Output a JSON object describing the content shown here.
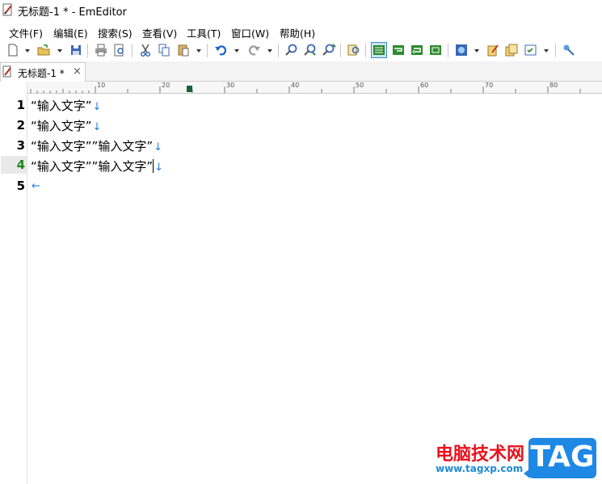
{
  "window": {
    "title": "无标题-1 * - EmEditor"
  },
  "menu": [
    "文件(F)",
    "编辑(E)",
    "搜索(S)",
    "查看(V)",
    "工具(T)",
    "窗口(W)",
    "帮助(H)"
  ],
  "tab": {
    "label": "无标题-1 *",
    "close": "×"
  },
  "ruler": {
    "marks": [
      "10",
      "20",
      "30",
      "40",
      "50",
      "60",
      "70",
      "80"
    ]
  },
  "lines": [
    {
      "number": "1",
      "text": "“输入文字”",
      "eol": "↓"
    },
    {
      "number": "2",
      "text": "“输入文字”",
      "eol": "↓"
    },
    {
      "number": "3",
      "text": "“输入文字””输入文字”",
      "eol": "↓"
    },
    {
      "number": "4",
      "text": "“输入文字””输入文字”",
      "eol": "↓"
    },
    {
      "number": "5",
      "text": "",
      "eol": "←"
    }
  ],
  "watermark": {
    "site_cn": "电脑技术网",
    "url": "www.tagxp.com",
    "tag": "TAG"
  },
  "colors": {
    "eol": "#1f7fdb",
    "watermark_red": "#e8121d",
    "watermark_blue": "#1e88e5"
  }
}
